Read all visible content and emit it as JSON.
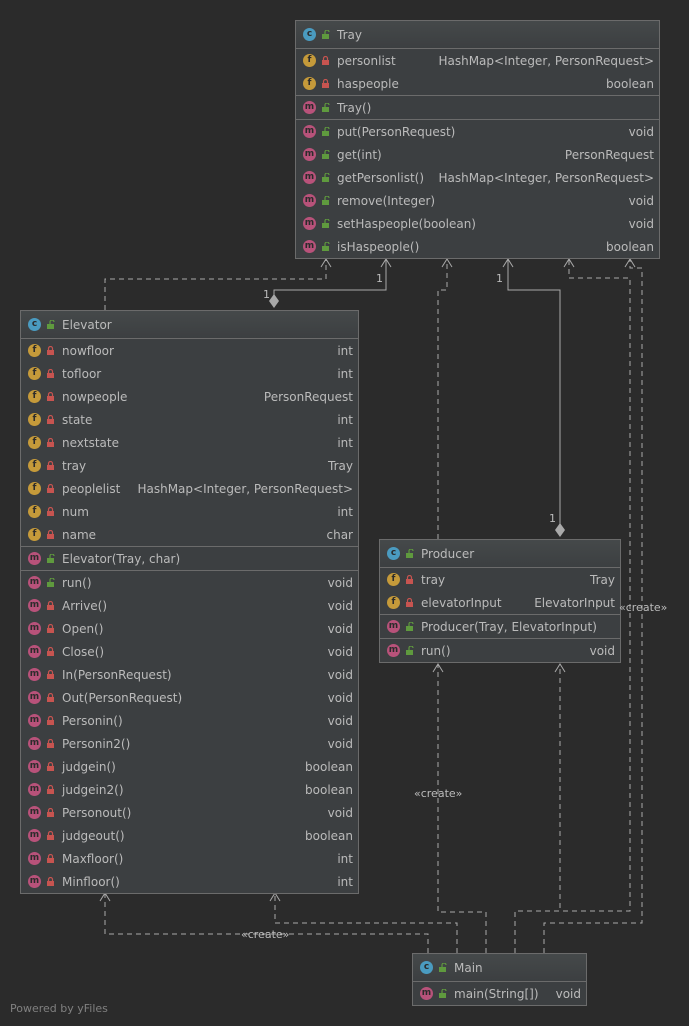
{
  "classes": {
    "tray": {
      "kind": "c",
      "name": "Tray",
      "sections": [
        [
          {
            "k": "f",
            "v": "private",
            "name": "personlist",
            "type": "HashMap<Integer, PersonRequest>"
          },
          {
            "k": "f",
            "v": "private",
            "name": "haspeople",
            "type": "boolean"
          }
        ],
        [
          {
            "k": "m",
            "v": "public",
            "name": "Tray()",
            "type": ""
          }
        ],
        [
          {
            "k": "m",
            "v": "public",
            "name": "put(PersonRequest)",
            "type": "void"
          },
          {
            "k": "m",
            "v": "public",
            "name": "get(int)",
            "type": "PersonRequest"
          },
          {
            "k": "m",
            "v": "public",
            "name": "getPersonlist()",
            "type": "HashMap<Integer, PersonRequest>"
          },
          {
            "k": "m",
            "v": "public",
            "name": "remove(Integer)",
            "type": "void"
          },
          {
            "k": "m",
            "v": "public",
            "name": "setHaspeople(boolean)",
            "type": "void"
          },
          {
            "k": "m",
            "v": "public",
            "name": "isHaspeople()",
            "type": "boolean"
          }
        ]
      ]
    },
    "elevator": {
      "kind": "c",
      "name": "Elevator",
      "sections": [
        [
          {
            "k": "f",
            "v": "private",
            "name": "nowfloor",
            "type": "int"
          },
          {
            "k": "f",
            "v": "private",
            "name": "tofloor",
            "type": "int"
          },
          {
            "k": "f",
            "v": "private",
            "name": "nowpeople",
            "type": "PersonRequest"
          },
          {
            "k": "f",
            "v": "private",
            "name": "state",
            "type": "int"
          },
          {
            "k": "f",
            "v": "private",
            "name": "nextstate",
            "type": "int"
          },
          {
            "k": "f",
            "v": "private",
            "name": "tray",
            "type": "Tray"
          },
          {
            "k": "f",
            "v": "private",
            "name": "peoplelist",
            "type": "HashMap<Integer, PersonRequest>"
          },
          {
            "k": "f",
            "v": "private",
            "name": "num",
            "type": "int"
          },
          {
            "k": "f",
            "v": "private",
            "name": "name",
            "type": "char"
          }
        ],
        [
          {
            "k": "m",
            "v": "public",
            "name": "Elevator(Tray, char)",
            "type": ""
          }
        ],
        [
          {
            "k": "m",
            "v": "public",
            "name": "run()",
            "type": "void"
          },
          {
            "k": "m",
            "v": "private",
            "name": "Arrive()",
            "type": "void"
          },
          {
            "k": "m",
            "v": "private",
            "name": "Open()",
            "type": "void"
          },
          {
            "k": "m",
            "v": "private",
            "name": "Close()",
            "type": "void"
          },
          {
            "k": "m",
            "v": "private",
            "name": "In(PersonRequest)",
            "type": "void"
          },
          {
            "k": "m",
            "v": "private",
            "name": "Out(PersonRequest)",
            "type": "void"
          },
          {
            "k": "m",
            "v": "private",
            "name": "Personin()",
            "type": "void"
          },
          {
            "k": "m",
            "v": "private",
            "name": "Personin2()",
            "type": "void"
          },
          {
            "k": "m",
            "v": "private",
            "name": "judgein()",
            "type": "boolean"
          },
          {
            "k": "m",
            "v": "private",
            "name": "judgein2()",
            "type": "boolean"
          },
          {
            "k": "m",
            "v": "private",
            "name": "Personout()",
            "type": "void"
          },
          {
            "k": "m",
            "v": "private",
            "name": "judgeout()",
            "type": "boolean"
          },
          {
            "k": "m",
            "v": "private",
            "name": "Maxfloor()",
            "type": "int"
          },
          {
            "k": "m",
            "v": "private",
            "name": "Minfloor()",
            "type": "int"
          }
        ]
      ]
    },
    "producer": {
      "kind": "c",
      "name": "Producer",
      "sections": [
        [
          {
            "k": "f",
            "v": "private",
            "name": "tray",
            "type": "Tray"
          },
          {
            "k": "f",
            "v": "private",
            "name": "elevatorInput",
            "type": "ElevatorInput"
          }
        ],
        [
          {
            "k": "m",
            "v": "public",
            "name": "Producer(Tray, ElevatorInput)",
            "type": ""
          }
        ],
        [
          {
            "k": "m",
            "v": "public",
            "name": "run()",
            "type": "void"
          }
        ]
      ]
    },
    "main": {
      "kind": "c",
      "name": "Main",
      "sections": [
        [
          {
            "k": "m",
            "v": "public",
            "name": "main(String[])",
            "type": "void"
          }
        ]
      ]
    }
  },
  "edge_labels": {
    "mult_elevator_tray": "1",
    "mult_elevator_end": "1",
    "mult_producer_tray": "1",
    "mult_producer_end": "1",
    "create_producer": "«create»",
    "create_tray": "«create»",
    "create_elevator": "«create»"
  },
  "footer": "Powered by yFiles",
  "colors": {
    "background": "#2b2b2b",
    "panel": "#3c3f41",
    "border": "#6b6b6b",
    "class_badge": "#4a9bc0",
    "field_badge": "#c59a3a",
    "method_badge": "#b8527a",
    "private_lock": "#c75450",
    "public_lock": "#5f9a3e",
    "edge": "#a9a9a9"
  }
}
